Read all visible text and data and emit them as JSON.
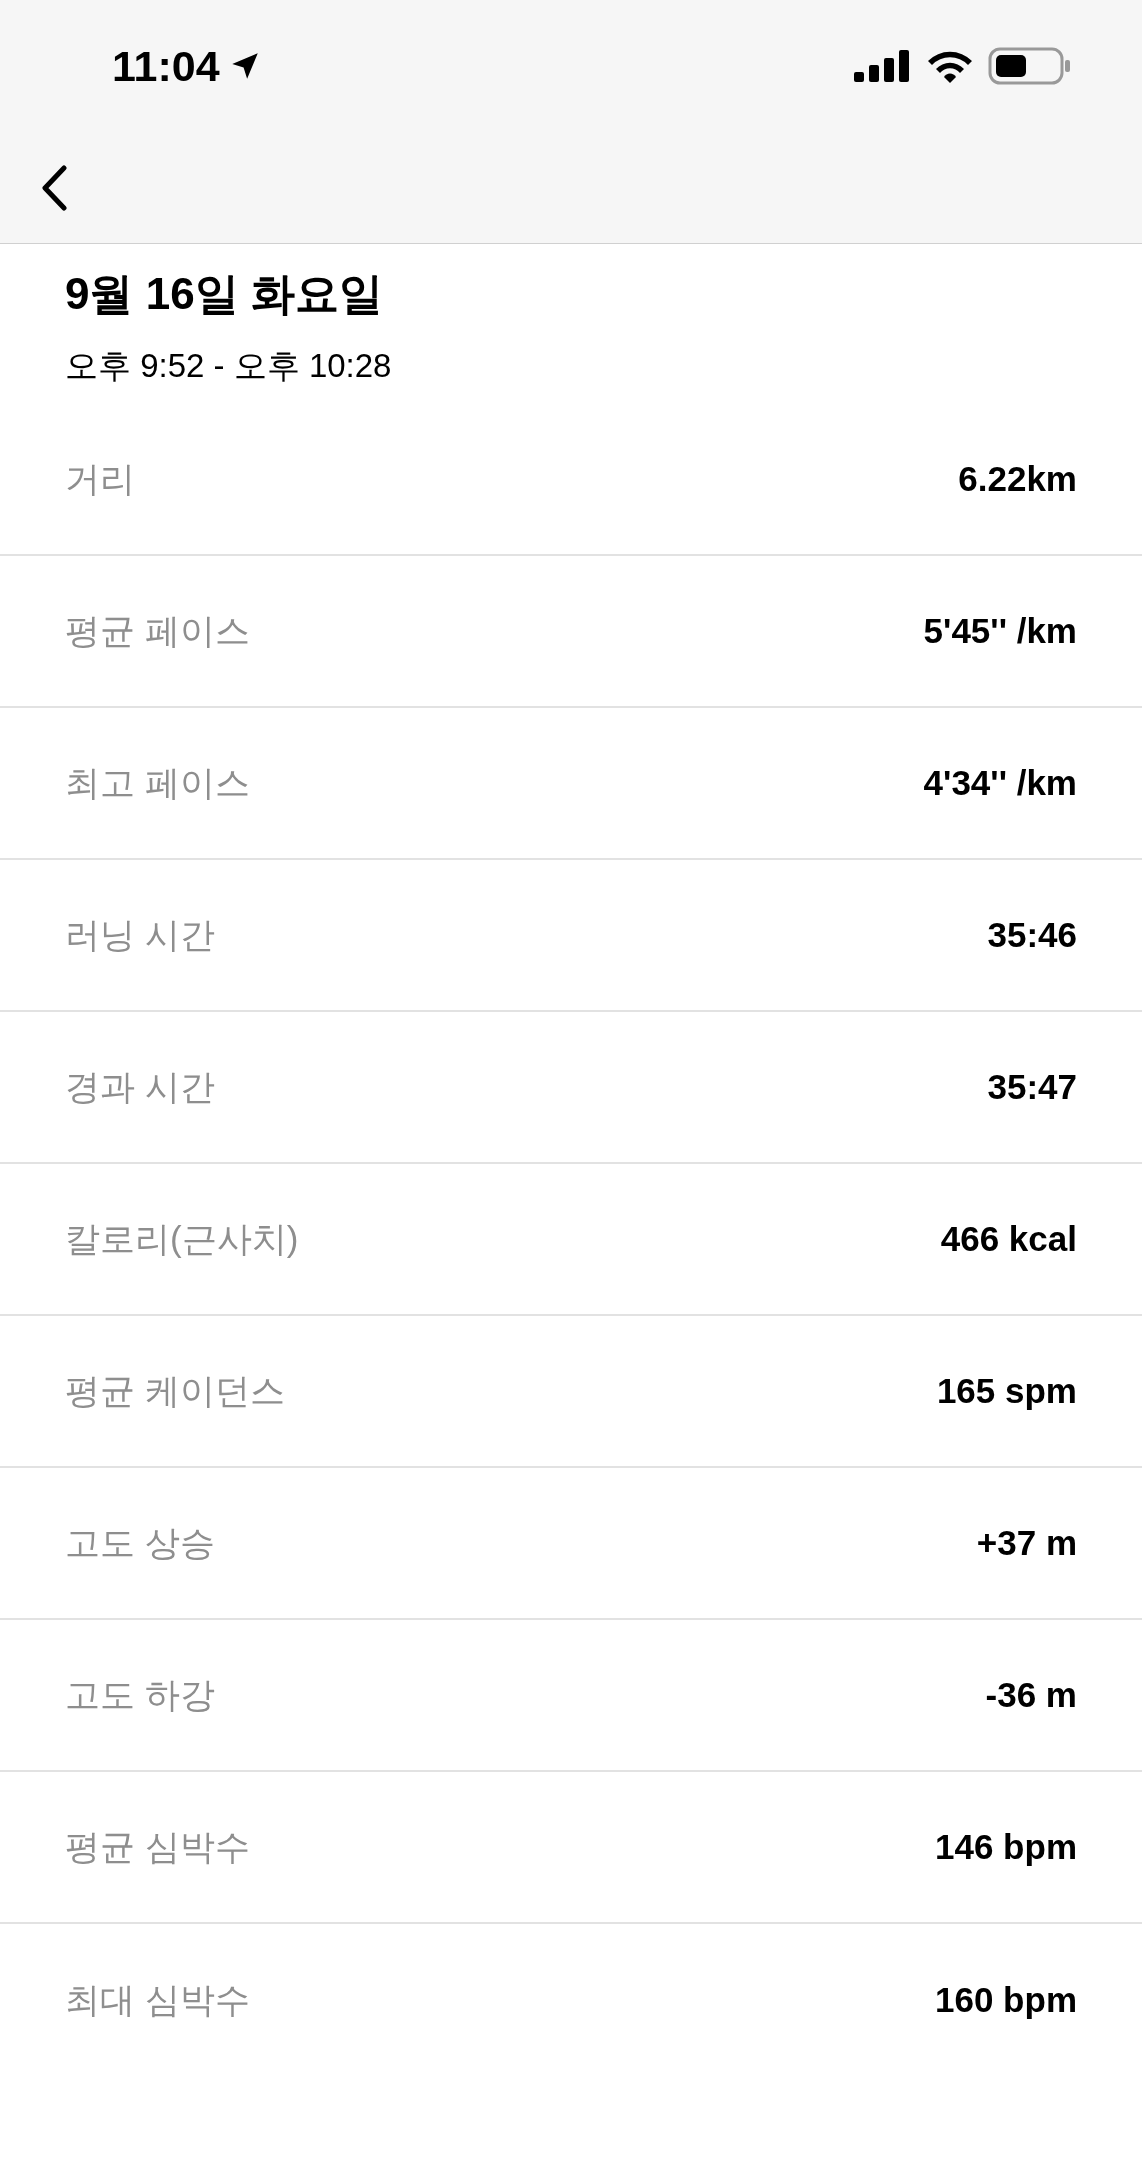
{
  "status_bar": {
    "time": "11:04"
  },
  "header": {
    "title": "9월 16일 화요일",
    "time_range": "오후 9:52 - 오후 10:28"
  },
  "stats": [
    {
      "label": "거리",
      "value": "6.22km"
    },
    {
      "label": "평균 페이스",
      "value": "5'45'' /km"
    },
    {
      "label": "최고 페이스",
      "value": "4'34'' /km"
    },
    {
      "label": "러닝 시간",
      "value": "35:46"
    },
    {
      "label": "경과 시간",
      "value": "35:47"
    },
    {
      "label": "칼로리(근사치)",
      "value": "466 kcal"
    },
    {
      "label": "평균 케이던스",
      "value": "165 spm"
    },
    {
      "label": "고도 상승",
      "value": "+37 m"
    },
    {
      "label": "고도 하강",
      "value": "-36 m"
    },
    {
      "label": "평균 심박수",
      "value": "146 bpm"
    },
    {
      "label": "최대 심박수",
      "value": "160 bpm"
    }
  ]
}
